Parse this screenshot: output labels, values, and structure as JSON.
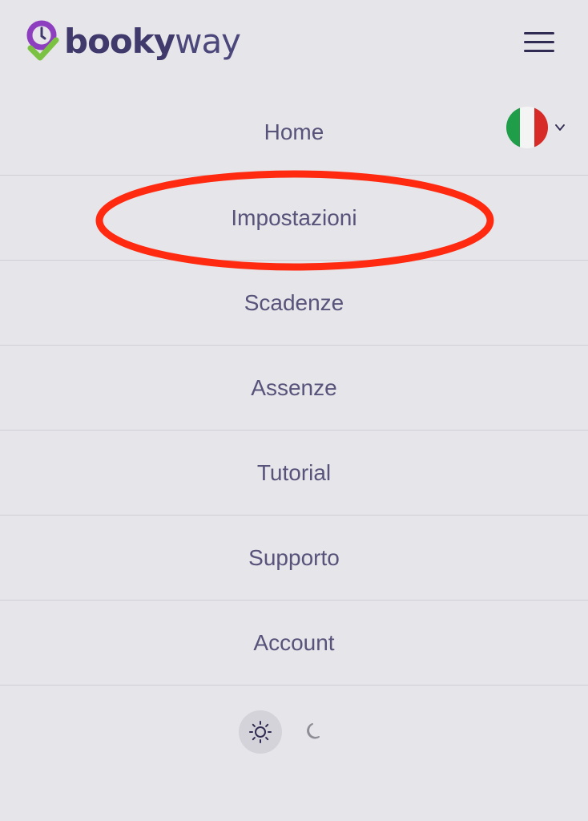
{
  "brand": {
    "name_part1": "booky",
    "name_part2": "way",
    "primary_color": "#3f3a6b",
    "accent_purple": "#8e3fbf",
    "accent_green": "#7cc242"
  },
  "header": {
    "menu_icon": "hamburger-icon"
  },
  "language": {
    "flag": "italian-flag-icon",
    "flag_colors": [
      "#1f9d48",
      "#f4f4f4",
      "#d62b27"
    ],
    "dropdown_icon": "chevron-down-icon"
  },
  "menu": {
    "items": [
      {
        "label": "Home"
      },
      {
        "label": "Impostazioni"
      },
      {
        "label": "Scadenze"
      },
      {
        "label": "Assenze"
      },
      {
        "label": "Tutorial"
      },
      {
        "label": "Supporto"
      },
      {
        "label": "Account"
      }
    ]
  },
  "theme": {
    "light_icon": "sun-icon",
    "dark_icon": "moon-icon",
    "selected": "light"
  },
  "annotation": {
    "color": "#ff2a10",
    "target": "Impostazioni"
  }
}
